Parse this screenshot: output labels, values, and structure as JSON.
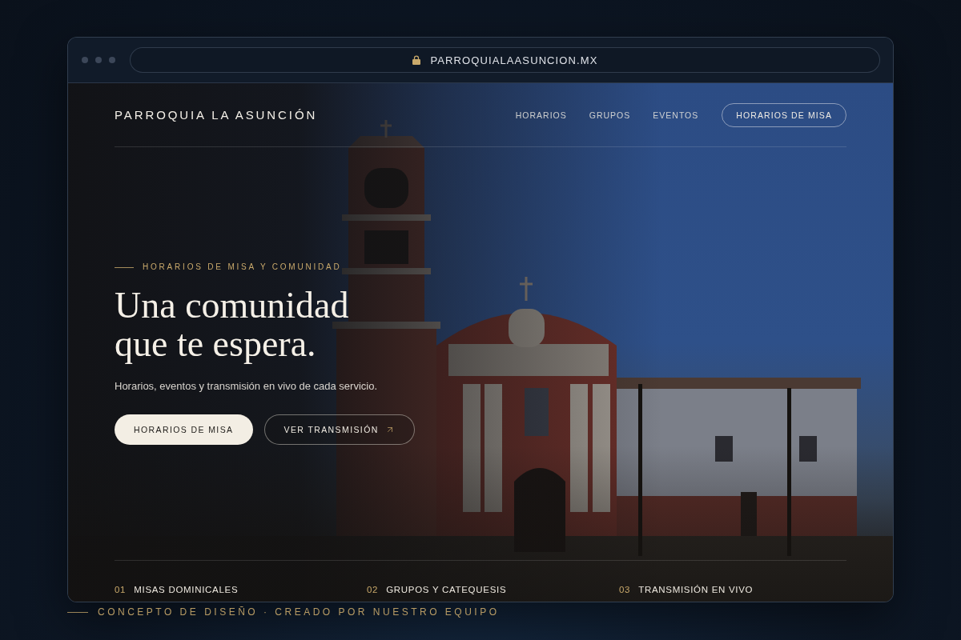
{
  "browser": {
    "url": "PARROQUIALAASUNCION.MX"
  },
  "nav": {
    "logo": "PARROQUIA LA ASUNCIÓN",
    "links": [
      "HORARIOS",
      "GRUPOS",
      "EVENTOS"
    ],
    "cta": "HORARIOS DE MISA"
  },
  "hero": {
    "eyebrow": "HORARIOS DE MISA Y COMUNIDAD",
    "title": "Una comunidad que te espera.",
    "subtitle": "Horarios, eventos y transmisión en vivo de cada servicio.",
    "buttons": [
      {
        "kind": "primary",
        "label": "HORARIOS DE MISA"
      },
      {
        "kind": "outline",
        "label": "VER TRANSMISIÓN"
      }
    ]
  },
  "features": [
    {
      "number": "01",
      "label": "MISAS DOMINICALES"
    },
    {
      "number": "02",
      "label": "GRUPOS Y CATEQUESIS"
    },
    {
      "number": "03",
      "label": "TRANSMISIÓN EN VIVO"
    }
  ],
  "caption": "CONCEPTO DE DISEÑO · CREADO POR NUESTRO EQUIPO"
}
